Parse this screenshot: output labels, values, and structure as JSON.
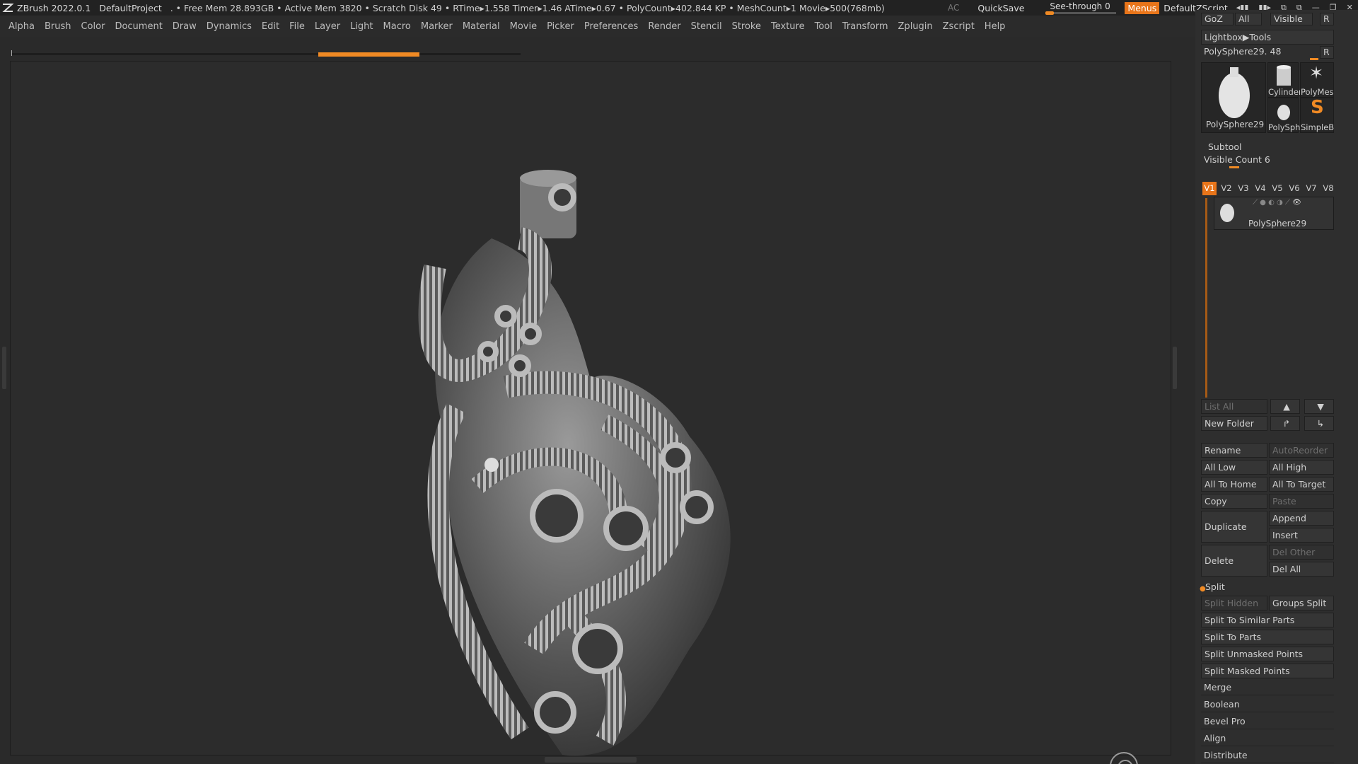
{
  "titlebar": {
    "app": "ZBrush 2022.0.1",
    "project": "DefaultProject",
    "stats": ". • Free Mem 28.893GB • Active Mem 3820 • Scratch Disk 49 •  RTime▸1.558 Timer▸1.46 ATime▸0.67 • PolyCount▸402.844 KP  • MeshCount▸1  Movie▸500(768mb)",
    "ac": "AC",
    "quicksave": "QuickSave",
    "see_through": "See-through  0",
    "menus": "Menus",
    "script": "DefaultZScript"
  },
  "menubar": [
    "Alpha",
    "Brush",
    "Color",
    "Document",
    "Draw",
    "Dynamics",
    "Edit",
    "File",
    "Layer",
    "Light",
    "Macro",
    "Marker",
    "Material",
    "Movie",
    "Picker",
    "Preferences",
    "Render",
    "Stencil",
    "Stroke",
    "Texture",
    "Tool",
    "Transform",
    "Zplugin",
    "Zscript",
    "Help"
  ],
  "tool_panel": {
    "goz": "GoZ",
    "all": "All",
    "visible": "Visible",
    "r": "R",
    "lightbox_tools": "Lightbox▶Tools",
    "tool_name": "PolySphere29. 48",
    "r2": "R",
    "thumbs": {
      "main": "PolySphere29",
      "cylinder": "Cylinder",
      "polymesh": "PolyMes",
      "polysph": "PolySph",
      "simpleb": "SimpleB"
    }
  },
  "subtool": {
    "title": "Subtool",
    "visible_count": "Visible Count 6",
    "tabs": [
      "V1",
      "V2",
      "V3",
      "V4",
      "V5",
      "V6",
      "V7",
      "V8"
    ],
    "active_tab": "V1",
    "item_name": "PolySphere29",
    "list_all": "List All",
    "new_folder": "New Folder",
    "rename": "Rename",
    "auto_reorder": "AutoReorder",
    "all_low": "All Low",
    "all_high": "All High",
    "all_to_home": "All To Home",
    "all_to_target": "All To Target",
    "copy": "Copy",
    "paste": "Paste",
    "duplicate": "Duplicate",
    "append": "Append",
    "insert": "Insert",
    "delete": "Delete",
    "del_other": "Del Other",
    "del_all": "Del All"
  },
  "split": {
    "title": "Split",
    "split_hidden": "Split Hidden",
    "groups_split": "Groups Split",
    "similar": "Split To Similar Parts",
    "to_parts": "Split To Parts",
    "unmasked": "Split Unmasked Points",
    "masked": "Split Masked Points"
  },
  "sections": [
    "Merge",
    "Boolean",
    "Bevel Pro",
    "Align",
    "Distribute"
  ],
  "colors": {
    "accent": "#e8751a",
    "bg": "#2a2a2a"
  }
}
